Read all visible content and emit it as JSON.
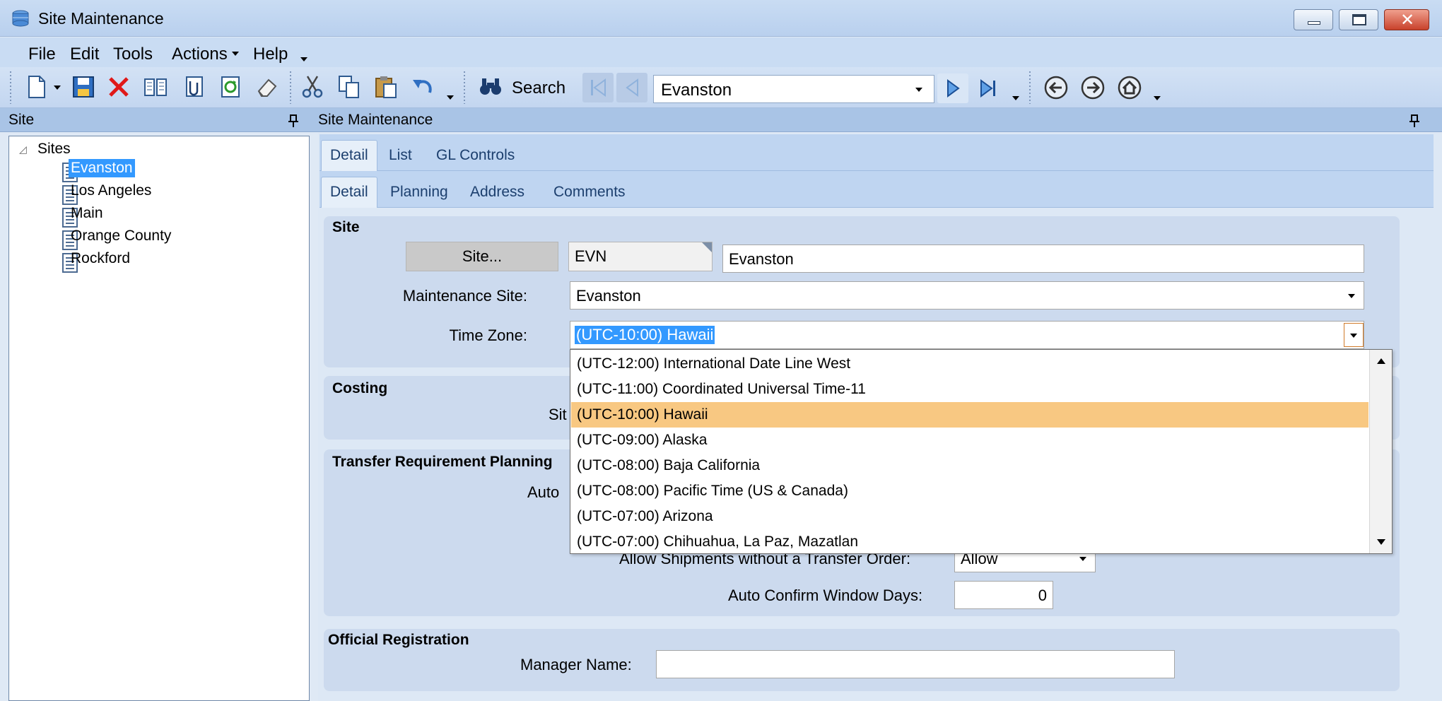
{
  "window": {
    "title": "Site Maintenance"
  },
  "menu": {
    "items": [
      "File",
      "Edit",
      "Tools",
      "Actions",
      "Help"
    ]
  },
  "toolbar": {
    "search_label": "Search",
    "nav_value": "Evanston",
    "icons": [
      "new-icon",
      "save-icon",
      "delete-icon",
      "open-icon",
      "attach-icon",
      "refresh-icon",
      "clear-icon",
      "cut-icon",
      "copy-icon",
      "paste-icon",
      "undo-icon",
      "search-icon",
      "first-icon",
      "prev-icon",
      "next-icon",
      "last-icon",
      "back-icon",
      "forward-icon",
      "home-icon"
    ]
  },
  "left_panel": {
    "header": "Site",
    "root": "Sites",
    "items": [
      "Evanston",
      "Los Angeles",
      "Main",
      "Orange County",
      "Rockford"
    ],
    "selected": "Evanston"
  },
  "right_panel": {
    "header": "Site Maintenance",
    "tabs_top": [
      "Detail",
      "List",
      "GL Controls"
    ],
    "tabs_sub": [
      "Detail",
      "Planning",
      "Address",
      "Comments"
    ]
  },
  "site_group": {
    "title": "Site",
    "site_button": "Site...",
    "site_code": "EVN",
    "site_name": "Evanston",
    "maintenance_label": "Maintenance Site:",
    "maintenance_value": "Evanston",
    "timezone_label": "Time Zone:",
    "timezone_value": "(UTC-10:00) Hawaii"
  },
  "costing_group": {
    "title": "Costing",
    "partial_label": "Sit"
  },
  "transfer_group": {
    "title": "Transfer Requirement Planning",
    "partial_label": "Auto",
    "allow_label": "Allow Shipments without a Transfer Order:",
    "allow_value": "Allow",
    "auto_confirm_label": "Auto Confirm Window Days:",
    "auto_confirm_value": "0"
  },
  "official_group": {
    "title": "Official Registration",
    "manager_label": "Manager Name:",
    "manager_value": ""
  },
  "timezone_options": [
    "(UTC-12:00) International Date Line West",
    "(UTC-11:00) Coordinated Universal Time-11",
    "(UTC-10:00) Hawaii",
    "(UTC-09:00) Alaska",
    "(UTC-08:00) Baja California",
    "(UTC-08:00) Pacific Time (US & Canada)",
    "(UTC-07:00) Arizona",
    "(UTC-07:00) Chihuahua, La Paz, Mazatlan"
  ],
  "colors": {
    "selection": "#3399ff",
    "highlight": "#f8c882",
    "panel_header": "#a9c4e6"
  }
}
